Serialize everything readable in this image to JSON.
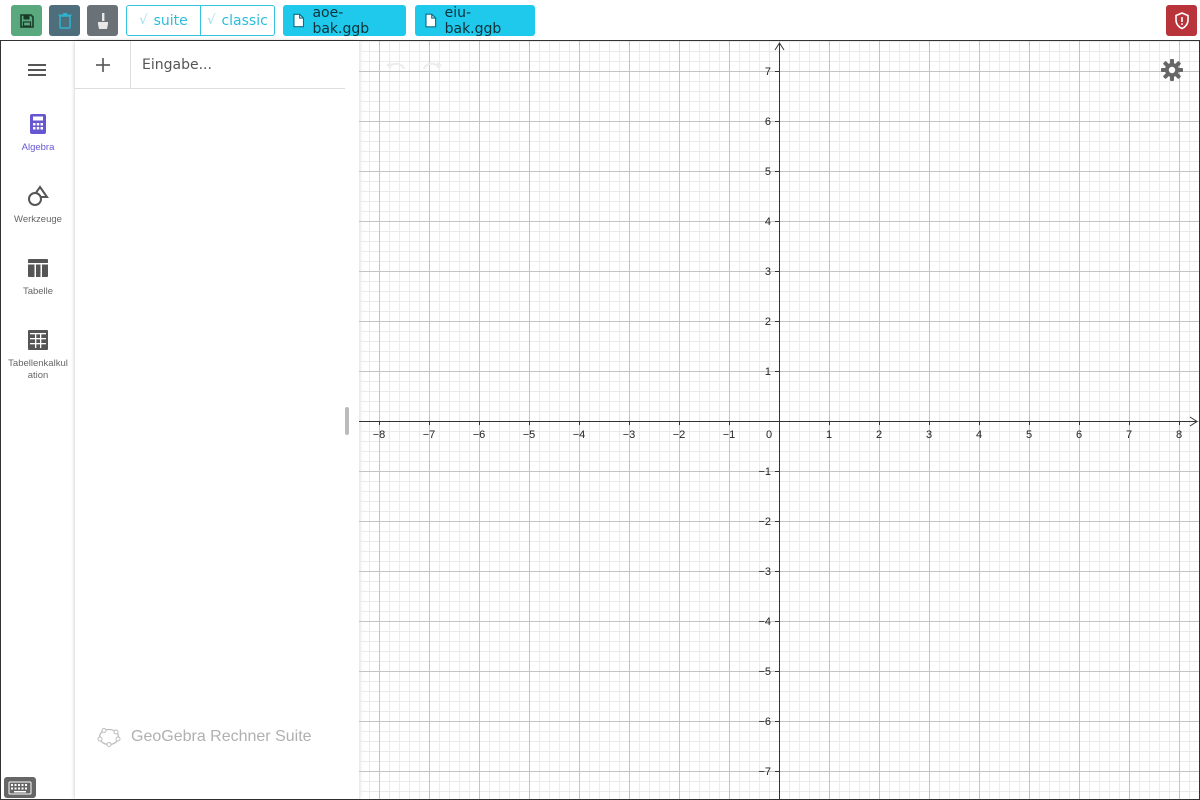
{
  "toolbar": {
    "save_icon": "floppy-icon",
    "trash_icon": "trash-icon",
    "brush_icon": "brush-icon",
    "segments": [
      {
        "check": "√",
        "label": "suite"
      },
      {
        "check": "√",
        "label": "classic"
      }
    ],
    "files": [
      {
        "label": "aoe-bak.ggb",
        "icon": "file-icon"
      },
      {
        "label": "eiu-bak.ggb",
        "icon": "file-icon"
      }
    ],
    "shield_icon": "shield-icon",
    "colors": {
      "save": "#5aa87e",
      "file": "#1ec9ec",
      "shield": "#b8333a",
      "segment": "#35c2df"
    }
  },
  "rail": {
    "items": [
      {
        "label": "Algebra",
        "icon": "calculator-icon",
        "active": true
      },
      {
        "label": "Werkzeuge",
        "icon": "shapes-icon",
        "active": false
      },
      {
        "label": "Tabelle",
        "icon": "table-icon",
        "active": false
      },
      {
        "label": "Tabellenkalkul ation",
        "icon": "spreadsheet-icon",
        "active": false
      }
    ],
    "accent": "#6557d2"
  },
  "algebra": {
    "input_placeholder": "Eingabe...",
    "brand": "GeoGebra Rechner Suite"
  },
  "graphics": {
    "x_ticks": [
      "−8",
      "−7",
      "−6",
      "−5",
      "−4",
      "−3",
      "−2",
      "−1",
      "0",
      "1",
      "2",
      "3",
      "4",
      "5",
      "6",
      "7",
      "8"
    ],
    "y_ticks_pos": [
      "7",
      "6",
      "5",
      "4",
      "3",
      "2",
      "1"
    ],
    "y_ticks_neg": [
      "−1",
      "−2",
      "−3",
      "−4",
      "−5",
      "−6",
      "−7"
    ],
    "x_range": [
      -8,
      8
    ],
    "y_range": [
      -7,
      7
    ],
    "grid": true
  }
}
